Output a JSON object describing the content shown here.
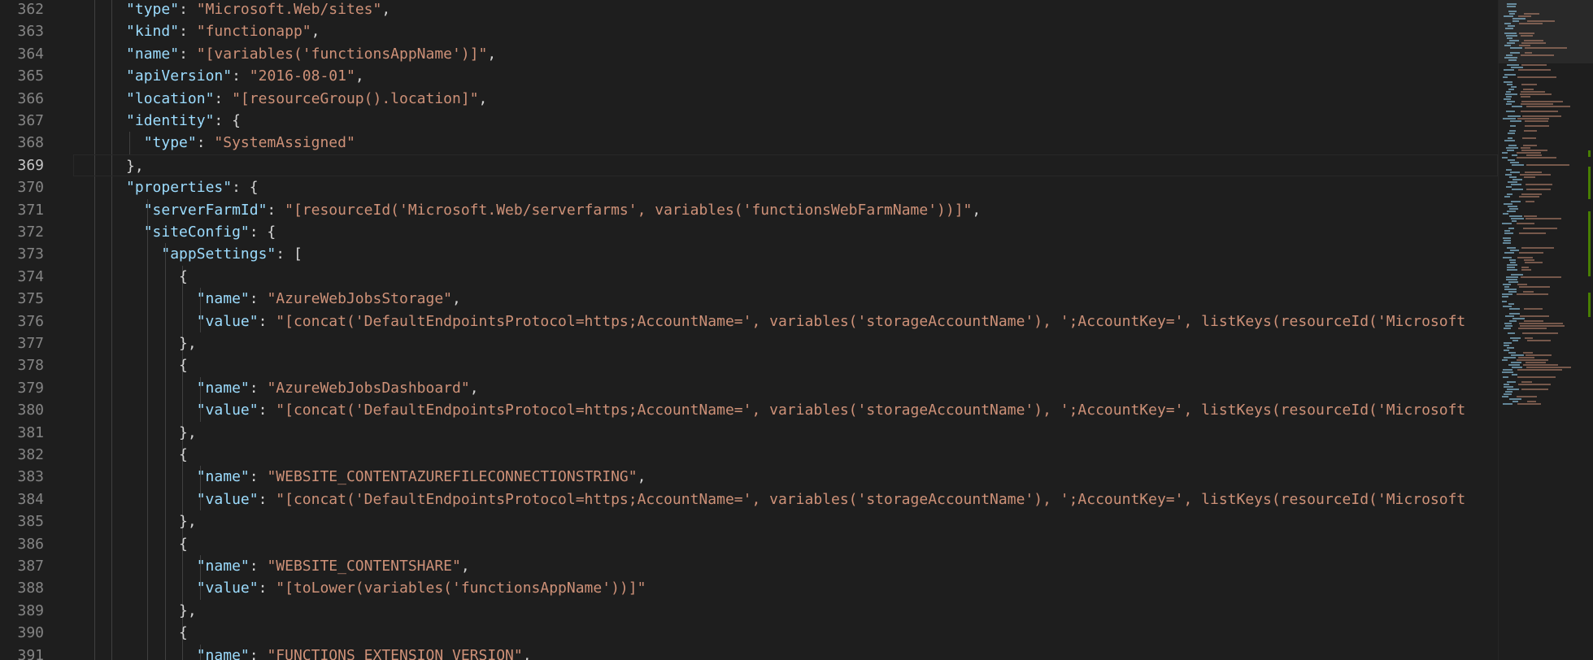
{
  "editor": {
    "language": "json",
    "current_line": "369",
    "colors": {
      "background": "#1e1e1e",
      "key": "#9cdcfe",
      "string": "#ce9178",
      "punctuation": "#d4d4d4",
      "line_number": "#858585",
      "line_number_active": "#c6c6c6",
      "added_marker": "#487e02"
    },
    "lines": [
      {
        "number": "362",
        "indent": 6,
        "tokens": [
          {
            "t": "k",
            "v": "\"type\""
          },
          {
            "t": "p",
            "v": ": "
          },
          {
            "t": "s",
            "v": "\"Microsoft.Web/sites\""
          },
          {
            "t": "p",
            "v": ","
          }
        ]
      },
      {
        "number": "363",
        "indent": 6,
        "tokens": [
          {
            "t": "k",
            "v": "\"kind\""
          },
          {
            "t": "p",
            "v": ": "
          },
          {
            "t": "s",
            "v": "\"functionapp\""
          },
          {
            "t": "p",
            "v": ","
          }
        ]
      },
      {
        "number": "364",
        "indent": 6,
        "tokens": [
          {
            "t": "k",
            "v": "\"name\""
          },
          {
            "t": "p",
            "v": ": "
          },
          {
            "t": "s",
            "v": "\"[variables('functionsAppName')]\""
          },
          {
            "t": "p",
            "v": ","
          }
        ]
      },
      {
        "number": "365",
        "indent": 6,
        "tokens": [
          {
            "t": "k",
            "v": "\"apiVersion\""
          },
          {
            "t": "p",
            "v": ": "
          },
          {
            "t": "s",
            "v": "\"2016-08-01\""
          },
          {
            "t": "p",
            "v": ","
          }
        ]
      },
      {
        "number": "366",
        "indent": 6,
        "tokens": [
          {
            "t": "k",
            "v": "\"location\""
          },
          {
            "t": "p",
            "v": ": "
          },
          {
            "t": "s",
            "v": "\"[resourceGroup().location]\""
          },
          {
            "t": "p",
            "v": ","
          }
        ]
      },
      {
        "number": "367",
        "indent": 6,
        "tokens": [
          {
            "t": "k",
            "v": "\"identity\""
          },
          {
            "t": "p",
            "v": ": {"
          }
        ]
      },
      {
        "number": "368",
        "indent": 8,
        "tokens": [
          {
            "t": "k",
            "v": "\"type\""
          },
          {
            "t": "p",
            "v": ": "
          },
          {
            "t": "s",
            "v": "\"SystemAssigned\""
          }
        ]
      },
      {
        "number": "369",
        "indent": 6,
        "tokens": [
          {
            "t": "p",
            "v": "},"
          }
        ]
      },
      {
        "number": "370",
        "indent": 6,
        "tokens": [
          {
            "t": "k",
            "v": "\"properties\""
          },
          {
            "t": "p",
            "v": ": {"
          }
        ]
      },
      {
        "number": "371",
        "indent": 8,
        "tokens": [
          {
            "t": "k",
            "v": "\"serverFarmId\""
          },
          {
            "t": "p",
            "v": ": "
          },
          {
            "t": "s",
            "v": "\"[resourceId('Microsoft.Web/serverfarms', variables('functionsWebFarmName'))]\""
          },
          {
            "t": "p",
            "v": ","
          }
        ]
      },
      {
        "number": "372",
        "indent": 8,
        "tokens": [
          {
            "t": "k",
            "v": "\"siteConfig\""
          },
          {
            "t": "p",
            "v": ": {"
          }
        ]
      },
      {
        "number": "373",
        "indent": 10,
        "tokens": [
          {
            "t": "k",
            "v": "\"appSettings\""
          },
          {
            "t": "p",
            "v": ": ["
          }
        ]
      },
      {
        "number": "374",
        "indent": 12,
        "tokens": [
          {
            "t": "p",
            "v": "{"
          }
        ]
      },
      {
        "number": "375",
        "indent": 14,
        "tokens": [
          {
            "t": "k",
            "v": "\"name\""
          },
          {
            "t": "p",
            "v": ": "
          },
          {
            "t": "s",
            "v": "\"AzureWebJobsStorage\""
          },
          {
            "t": "p",
            "v": ","
          }
        ]
      },
      {
        "number": "376",
        "indent": 14,
        "tokens": [
          {
            "t": "k",
            "v": "\"value\""
          },
          {
            "t": "p",
            "v": ": "
          },
          {
            "t": "s",
            "v": "\"[concat('DefaultEndpointsProtocol=https;AccountName=', variables('storageAccountName'), ';AccountKey=', listKeys(resourceId('Microsoft"
          }
        ]
      },
      {
        "number": "377",
        "indent": 12,
        "tokens": [
          {
            "t": "p",
            "v": "},"
          }
        ]
      },
      {
        "number": "378",
        "indent": 12,
        "tokens": [
          {
            "t": "p",
            "v": "{"
          }
        ]
      },
      {
        "number": "379",
        "indent": 14,
        "tokens": [
          {
            "t": "k",
            "v": "\"name\""
          },
          {
            "t": "p",
            "v": ": "
          },
          {
            "t": "s",
            "v": "\"AzureWebJobsDashboard\""
          },
          {
            "t": "p",
            "v": ","
          }
        ]
      },
      {
        "number": "380",
        "indent": 14,
        "tokens": [
          {
            "t": "k",
            "v": "\"value\""
          },
          {
            "t": "p",
            "v": ": "
          },
          {
            "t": "s",
            "v": "\"[concat('DefaultEndpointsProtocol=https;AccountName=', variables('storageAccountName'), ';AccountKey=', listKeys(resourceId('Microsoft"
          }
        ]
      },
      {
        "number": "381",
        "indent": 12,
        "tokens": [
          {
            "t": "p",
            "v": "},"
          }
        ]
      },
      {
        "number": "382",
        "indent": 12,
        "tokens": [
          {
            "t": "p",
            "v": "{"
          }
        ]
      },
      {
        "number": "383",
        "indent": 14,
        "tokens": [
          {
            "t": "k",
            "v": "\"name\""
          },
          {
            "t": "p",
            "v": ": "
          },
          {
            "t": "s",
            "v": "\"WEBSITE_CONTENTAZUREFILECONNECTIONSTRING\""
          },
          {
            "t": "p",
            "v": ","
          }
        ]
      },
      {
        "number": "384",
        "indent": 14,
        "tokens": [
          {
            "t": "k",
            "v": "\"value\""
          },
          {
            "t": "p",
            "v": ": "
          },
          {
            "t": "s",
            "v": "\"[concat('DefaultEndpointsProtocol=https;AccountName=', variables('storageAccountName'), ';AccountKey=', listKeys(resourceId('Microsoft"
          }
        ]
      },
      {
        "number": "385",
        "indent": 12,
        "tokens": [
          {
            "t": "p",
            "v": "},"
          }
        ]
      },
      {
        "number": "386",
        "indent": 12,
        "tokens": [
          {
            "t": "p",
            "v": "{"
          }
        ]
      },
      {
        "number": "387",
        "indent": 14,
        "tokens": [
          {
            "t": "k",
            "v": "\"name\""
          },
          {
            "t": "p",
            "v": ": "
          },
          {
            "t": "s",
            "v": "\"WEBSITE_CONTENTSHARE\""
          },
          {
            "t": "p",
            "v": ","
          }
        ]
      },
      {
        "number": "388",
        "indent": 14,
        "tokens": [
          {
            "t": "k",
            "v": "\"value\""
          },
          {
            "t": "p",
            "v": ": "
          },
          {
            "t": "s",
            "v": "\"[toLower(variables('functionsAppName'))]\""
          }
        ]
      },
      {
        "number": "389",
        "indent": 12,
        "tokens": [
          {
            "t": "p",
            "v": "},"
          }
        ]
      },
      {
        "number": "390",
        "indent": 12,
        "tokens": [
          {
            "t": "p",
            "v": "{"
          }
        ]
      },
      {
        "number": "391",
        "indent": 14,
        "tokens": [
          {
            "t": "k",
            "v": "\"name\""
          },
          {
            "t": "p",
            "v": ": "
          },
          {
            "t": "s",
            "v": "\"FUNCTIONS_EXTENSION_VERSION\""
          },
          {
            "t": "p",
            "v": ","
          }
        ]
      }
    ]
  }
}
